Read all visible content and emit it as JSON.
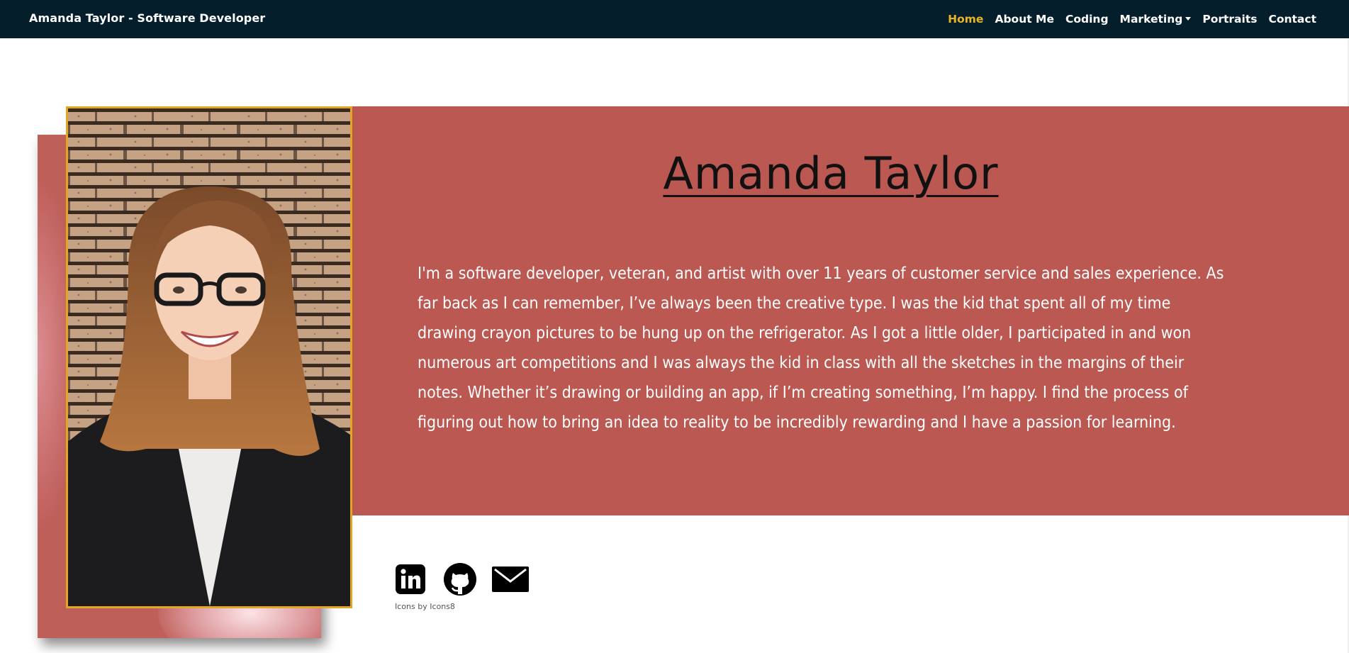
{
  "navbar": {
    "brand": "Amanda Taylor - Software Developer",
    "links": [
      {
        "label": "Home",
        "active": true
      },
      {
        "label": "About Me"
      },
      {
        "label": "Coding"
      },
      {
        "label": "Marketing",
        "dropdown": true
      },
      {
        "label": "Portraits"
      },
      {
        "label": "Contact"
      }
    ],
    "colors": {
      "background": "#041e2c",
      "active": "#e9b423",
      "text": "#ffffff"
    }
  },
  "hero": {
    "name": "Amanda Taylor",
    "bio": "I'm a software developer, veteran, and artist with over 11 years of customer service and sales experience. As far back as I can remember, I’ve always been the creative type. I was the kid that spent all of my time drawing crayon pictures to be hung up on the refrigerator. As I got a little older, I participated in and won numerous art competitions and I was always the kid in class with all the sketches in the margins of their notes. Whether it’s drawing or building an app, if I’m creating something, I’m happy. I find the process of figuring out how to bring an idea to reality to be incredibly rewarding and I have a passion for learning.",
    "band_color": "#bb5852",
    "frame_color": "#e2a623"
  },
  "social": {
    "icons": [
      "linkedin-icon",
      "github-icon",
      "email-icon"
    ],
    "credit": "Icons by Icons8"
  }
}
